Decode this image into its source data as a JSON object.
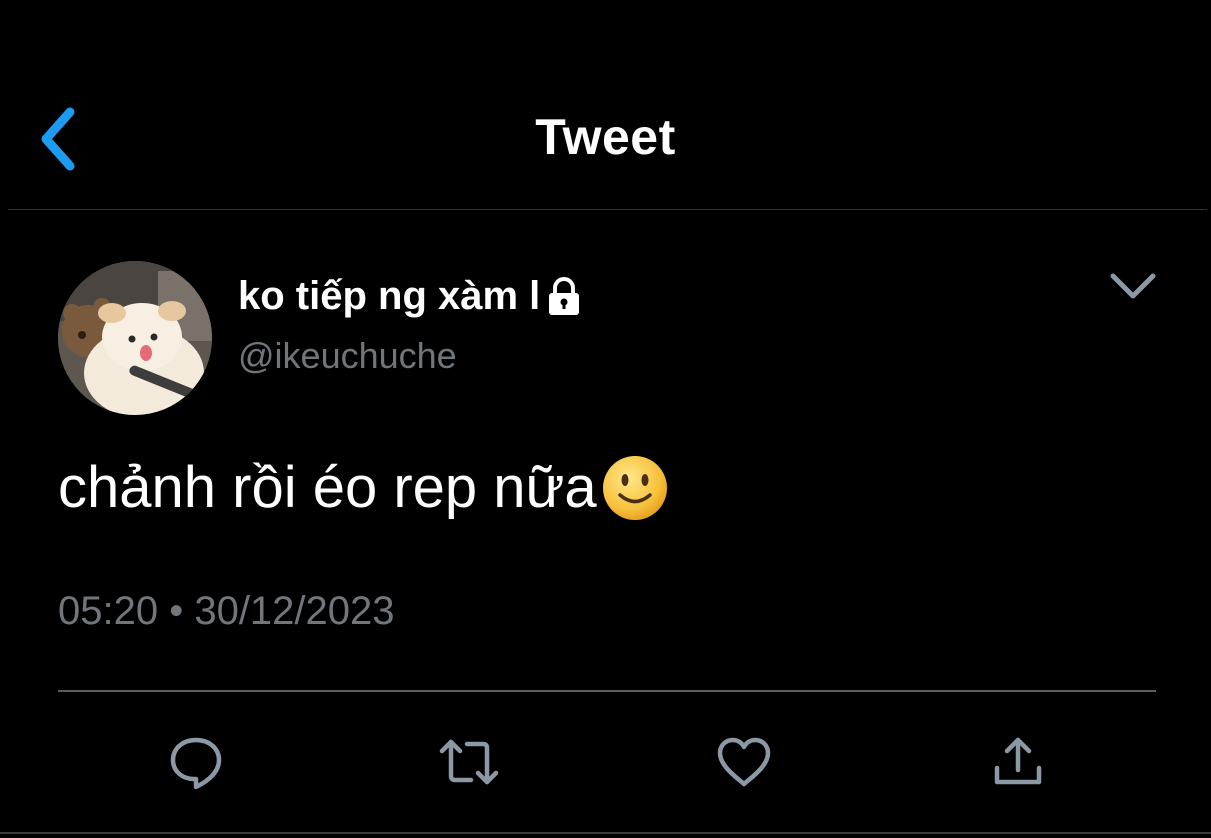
{
  "header": {
    "title": "Tweet",
    "back_icon": "chevron-left-icon"
  },
  "tweet": {
    "author_name": "ko tiếp ng xàm l",
    "author_handle": "@ikeuchuche",
    "protected_icon": "lock-icon",
    "text": "chảnh rồi éo rep nữa",
    "emoji": "slightly-smiling-face",
    "time": "05:20 • 30/12/2023",
    "menu_icon": "chevron-down-icon"
  },
  "actions": [
    {
      "name": "reply",
      "icon": "reply-icon"
    },
    {
      "name": "retweet",
      "icon": "retweet-icon"
    },
    {
      "name": "like",
      "icon": "heart-icon"
    },
    {
      "name": "share",
      "icon": "share-icon"
    }
  ],
  "colors": {
    "background": "#000000",
    "text": "#ffffff",
    "secondary_text": "#71767b",
    "accent": "#1d9bf0",
    "icon": "#8b98a5"
  }
}
